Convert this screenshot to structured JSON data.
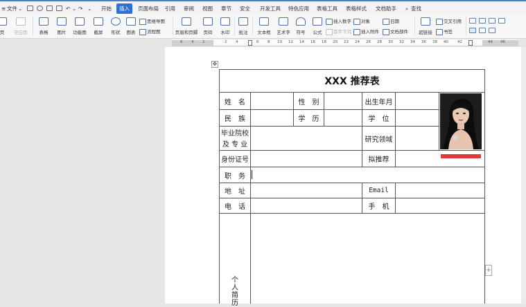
{
  "menubar": {
    "file": "文件",
    "tabs": [
      "开始",
      "插入",
      "页面布局",
      "引用",
      "审阅",
      "视图",
      "章节",
      "安全",
      "开发工具",
      "特色应用",
      "表格工具",
      "表格样式",
      "文档助手"
    ],
    "active_tab": "插入",
    "search": "查找"
  },
  "ribbon": {
    "page": "页",
    "blank_page": "空白页",
    "table": "表格",
    "picture": "图片",
    "function_chart": "功能图",
    "screenshot": "截屏",
    "shape": "形状",
    "chart": "图表",
    "mind_map": "思维导图",
    "flowchart": "流程图",
    "header_footer": "页眉和页脚",
    "page_number": "页码",
    "watermark": "水印",
    "comment": "批注",
    "text_box": "文本框",
    "art_text": "艺术字",
    "symbol": "符号",
    "formula": "公式",
    "insert_number": "插入数字",
    "object": "对象",
    "first_drop": "首字下沉",
    "insert_attachment": "插入附件",
    "date": "日期",
    "document_parts": "文档部件",
    "hyperlink": "超链接",
    "cross_ref": "交叉引用",
    "bookmark": "书签"
  },
  "ruler": {
    "ticks": [
      "6",
      "4",
      "2",
      "2",
      "4",
      "6",
      "8",
      "10",
      "12",
      "14",
      "16",
      "18",
      "20",
      "22",
      "24",
      "26",
      "28",
      "30",
      "32",
      "34",
      "36",
      "38",
      "40",
      "42",
      "44",
      "46"
    ]
  },
  "form": {
    "title": "XXX 推荐表",
    "name": "姓　名",
    "gender": "性　别",
    "birth": "出生年月",
    "ethnicity": "民　族",
    "education": "学　历",
    "degree": "学　位",
    "school_line1": "毕业院校",
    "school_line2": "及 专 业",
    "research": "研究领域",
    "id_number": "身份证号",
    "recommend": "拟推荐",
    "position": "职　务",
    "address": "地　址",
    "email": "Email",
    "phone": "电　话",
    "mobile": "手　机",
    "resume": [
      "个",
      "人",
      "简",
      "历"
    ]
  },
  "colors": {
    "accent": "#2f6fd2",
    "red_bar": "#e0393a",
    "page": "#ffffff",
    "workspace": "#e6e6e6"
  }
}
